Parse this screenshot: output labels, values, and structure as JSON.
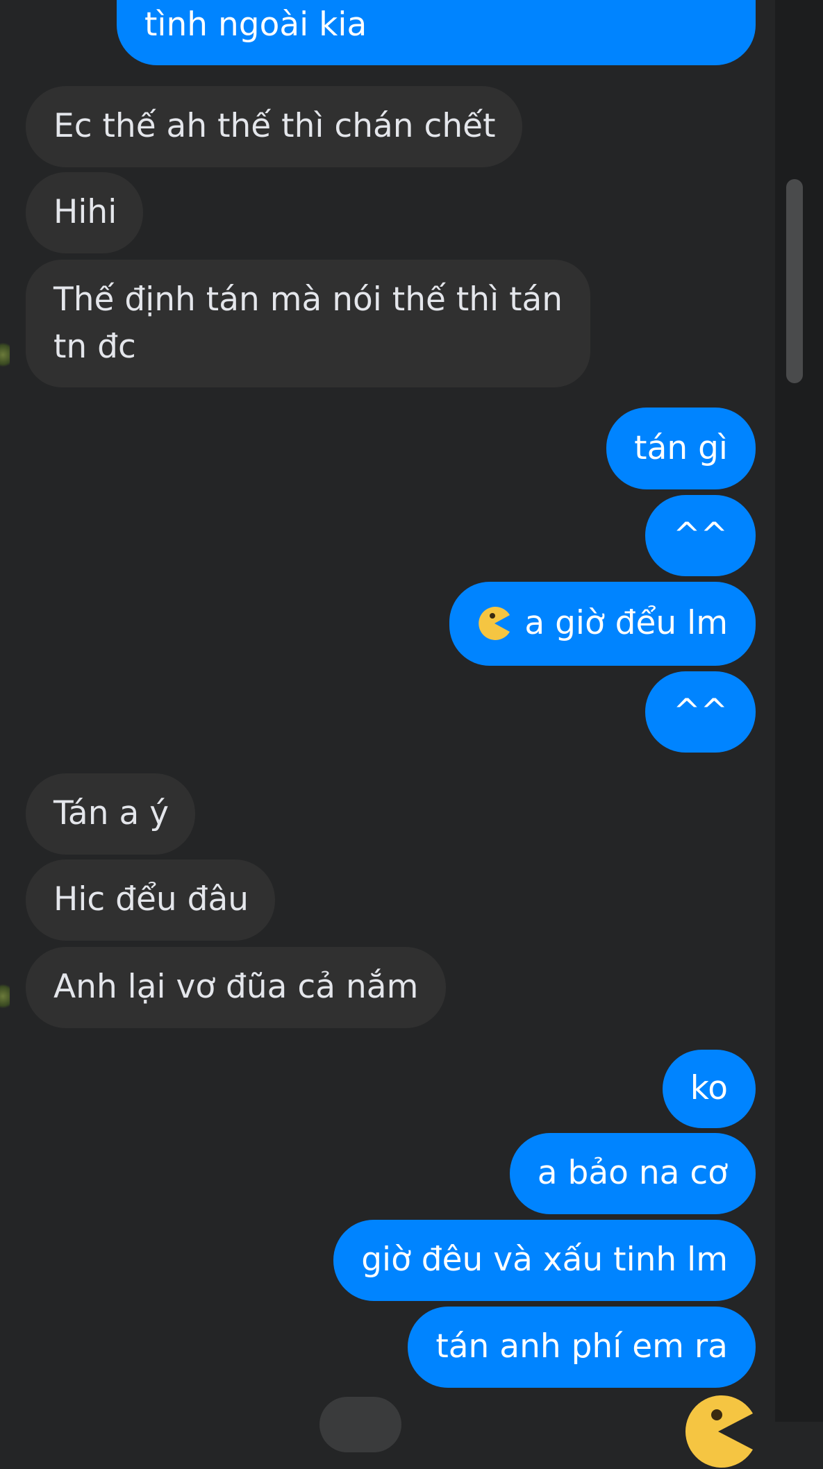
{
  "conversation": {
    "messages": [
      {
        "sender": "me",
        "text": "tình ngoài kia"
      },
      {
        "sender": "other",
        "text": "Ec thế ah thế thì chán chết"
      },
      {
        "sender": "other",
        "text": "Hihi"
      },
      {
        "sender": "other",
        "line1": "Thế định tán mà nói thế thì tán",
        "line2": "tn đc"
      },
      {
        "sender": "me",
        "text": "tán gì"
      },
      {
        "sender": "me",
        "text": "^^"
      },
      {
        "sender": "me",
        "text": "a giờ đểu lm",
        "emoji": "pacman-emoji"
      },
      {
        "sender": "me",
        "text": "^^"
      },
      {
        "sender": "other",
        "text": "Tán a ý"
      },
      {
        "sender": "other",
        "text": "Hic đểu đâu"
      },
      {
        "sender": "other",
        "text": "Anh lại vơ đũa cả nắm"
      },
      {
        "sender": "me",
        "text": "ko"
      },
      {
        "sender": "me",
        "text": "a bảo na cơ"
      },
      {
        "sender": "me",
        "text": "giờ đêu và xấu tinh lm"
      },
      {
        "sender": "me",
        "text": "tán anh phí em ra"
      }
    ]
  },
  "colors": {
    "background": "#242526",
    "incoming_bubble": "#303030",
    "outgoing_bubble": "#0084ff",
    "incoming_text": "#e4e6eb",
    "outgoing_text": "#ffffff",
    "emoji": "#f5c542"
  },
  "icons": {
    "emoji_icon": "pacman-emoji",
    "reaction_icon": "pacman-emoji"
  }
}
